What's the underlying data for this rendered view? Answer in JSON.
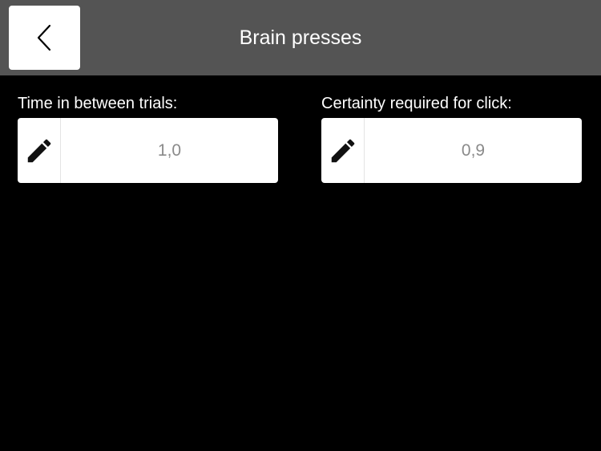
{
  "header": {
    "title": "Brain presses",
    "back_icon": "chevron-left-icon",
    "background_color": "#545454"
  },
  "settings": [
    {
      "label": "Time in between trials:",
      "value": "1,0",
      "icon": "pencil-icon"
    },
    {
      "label": "Certainty required for click:",
      "value": "0,9",
      "icon": "pencil-icon"
    }
  ],
  "colors": {
    "background": "#000000",
    "field_background": "#ffffff",
    "value_text": "#8a8a8a"
  }
}
